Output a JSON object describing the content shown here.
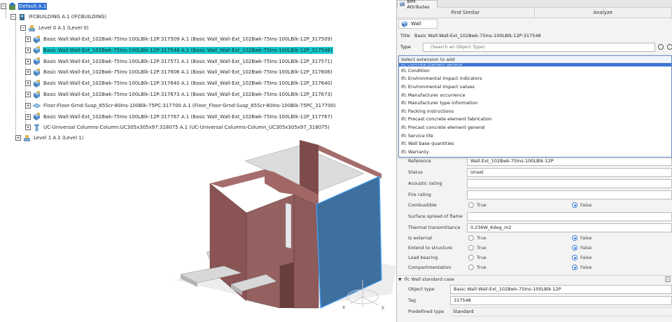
{
  "tree": {
    "root": "Default A.1",
    "building": "IFCBUILDING A.1 (IFCBUILDING)",
    "level0": "Level 0 A.1 (Level 0)",
    "items": [
      {
        "label": "Basic Wall:Wall-Ext_102Bwk-75Ins-100LBlk-12P:317509 A.1 (Basic Wall_Wall-Ext_102Bwk-75Ins-100LBlk-12P_317509)",
        "icon": "wall-icon",
        "selected": false
      },
      {
        "label": "Basic Wall:Wall-Ext_102Bwk-75Ins-100LBlk-12P:317548 A.1 (Basic Wall_Wall-Ext_102Bwk-75Ins-100LBlk-12P_317548)",
        "icon": "wall-icon",
        "selected": true
      },
      {
        "label": "Basic Wall:Wall-Ext_102Bwk-75Ins-100LBlk-12P:317571 A.1 (Basic Wall_Wall-Ext_102Bwk-75Ins-100LBlk-12P_317571)",
        "icon": "wall-icon",
        "selected": false
      },
      {
        "label": "Basic Wall:Wall-Ext_102Bwk-75Ins-100LBlk-12P:317606 A.1 (Basic Wall_Wall-Ext_102Bwk-75Ins-100LBlk-12P_317606)",
        "icon": "wall-icon",
        "selected": false
      },
      {
        "label": "Basic Wall:Wall-Ext_102Bwk-75Ins-100LBlk-12P:317640 A.1 (Basic Wall_Wall-Ext_102Bwk-75Ins-100LBlk-12P_317640)",
        "icon": "wall-icon",
        "selected": false
      },
      {
        "label": "Basic Wall:Wall-Ext_102Bwk-75Ins-100LBlk-12P:317673 A.1 (Basic Wall_Wall-Ext_102Bwk-75Ins-100LBlk-12P_317673)",
        "icon": "wall-icon",
        "selected": false
      },
      {
        "label": "Floor:Floor-Grnd-Susp_65Scr-80Ins-100Blk-75PC:317700 A.1 (Floor_Floor-Grnd-Susp_65Scr-80Ins-100Blk-75PC_317700)",
        "icon": "floor-icon",
        "selected": false
      },
      {
        "label": "Basic Wall:Wall-Ext_102Bwk-75Ins-100LBlk-12P:317767 A.1 (Basic Wall_Wall-Ext_102Bwk-75Ins-100LBlk-12P_317767)",
        "icon": "wall-icon",
        "selected": false
      },
      {
        "label": "UC-Universal Columns-Column:UC305x305x97:318075 A.1 (UC-Universal Columns-Column_UC305x305x97_318075)",
        "icon": "column-icon",
        "selected": false
      }
    ],
    "level1": "Level 1 A.1 (Level 1)"
  },
  "viewport": {
    "axis_x": "x",
    "axis_y": "y"
  },
  "panel": {
    "tab_title": "BIM Attributes",
    "find_similar": "Find Similar",
    "analyze": "Analyze",
    "object_tab": "Wall",
    "title_label": "Title",
    "title_value": "Basic Wall:Wall-Ext_102Bwk-75Ins-100LBlk-12P:317548",
    "type_label": "Type",
    "type_placeholder": "(Search an Object Type)"
  },
  "dropdown": {
    "header": "Select extension to add",
    "highlighted": "Ifc Concrete Element general",
    "items": [
      "Ifc Condition",
      "Ifc Environmental impact indicators",
      "Ifc Environmental impact values",
      "Ifc Manufacturer occurrence",
      "Ifc Manufacturer type information",
      "Ifc Packing instructions",
      "Ifc Precast concrete element fabrication",
      "Ifc Precast concrete element general",
      "Ifc Service life",
      "Ifc Wall base quantities",
      "Ifc Warranty"
    ]
  },
  "attributes": {
    "reference_label": "Reference",
    "reference_value": "Wall-Ext_102Bwk-75Ins-100LBlk-12P",
    "status_label": "Status",
    "status_value": "Unset",
    "acoustic_label": "Acoustic rating",
    "acoustic_value": "",
    "fire_label": "Fire rating",
    "fire_value": "",
    "combustible_label": "Combustible",
    "surface_label": "Surface spread of flame",
    "surface_value": "",
    "thermal_label": "Thermal transmittance",
    "thermal_value": "0.236W_Kdeg_m2",
    "is_external_label": "Is external",
    "extend_label": "Extend to structure",
    "load_label": "Load bearing",
    "compart_label": "Compartmentation",
    "true_label": "True",
    "false_label": "False"
  },
  "section": {
    "title": "Ifc Wall standard case",
    "object_type_label": "Object type",
    "object_type_value": "Basic Wall:Wall-Ext_102Bwk-75Ins-100LBlk-12P",
    "tag_label": "Tag",
    "tag_value": "317548",
    "predefined_label": "Predefined type",
    "predefined_value": "Standard"
  },
  "colors": {
    "accent": "#3d7fd6",
    "selection_cyan": "#16c8cc",
    "wall_brown": "#8a5454",
    "wall_blue": "#3e6f9d"
  }
}
